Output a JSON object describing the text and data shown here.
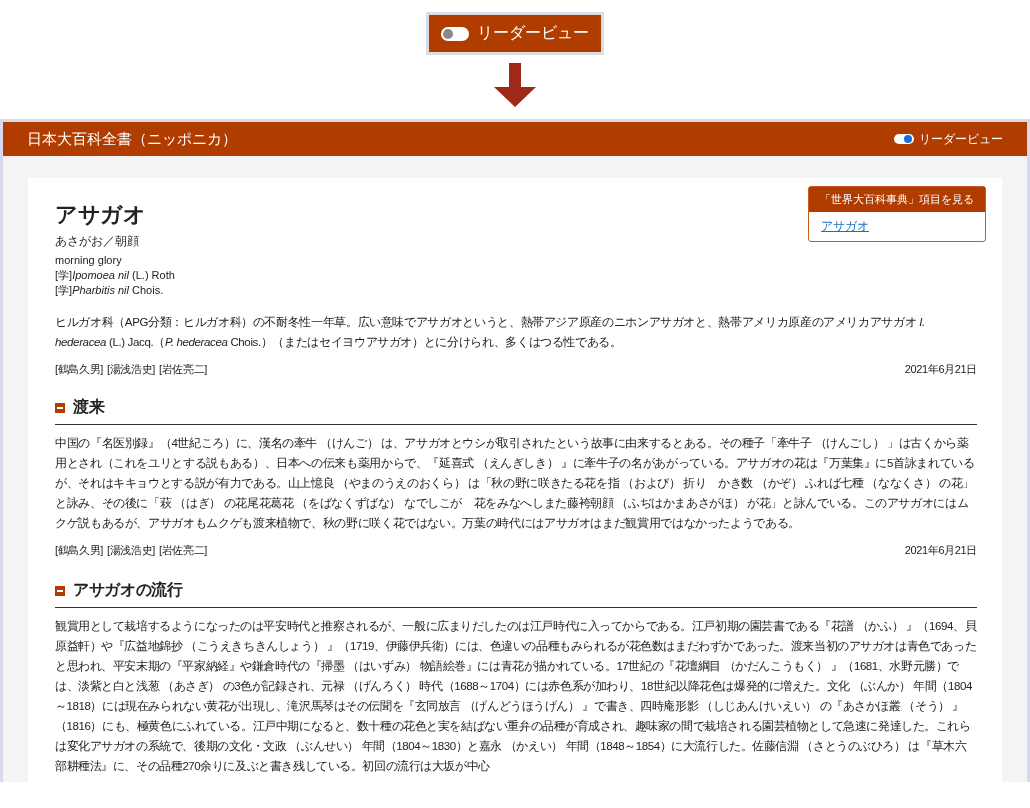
{
  "callout": {
    "toggle": {
      "label": "リーダービュー",
      "on": false
    }
  },
  "frame": {
    "header": {
      "title": "日本大百科全書（ニッポニカ）",
      "toggle": {
        "label": "リーダービュー",
        "on": true
      }
    },
    "article": {
      "title": "アサガオ",
      "reading": "あさがお／朝顔",
      "english": "morning glory",
      "scientific_names": [
        "[学]*Ipomoea nil* (L.) Roth",
        "[学]*Pharbitis nil* Chois."
      ],
      "related_box": {
        "heading": "「世界大百科事典」項目を見る",
        "link": "アサガオ"
      },
      "intro": {
        "text": "ヒルガオ科（APG分類：ヒルガオ科）の不耐冬性一年草。広い意味でアサガオというと、熱帯アジア原産のニホンアサガオと、熱帯アメリカ原産のアメリカアサガオ *I. hederacea* (L.) Jacq.（*P. hederacea* Chois.）（またはセイヨウアサガオ）とに分けられ、多くはつる性である。",
        "authors": [
          "[鶴島久男]",
          "[湯浅浩史]",
          "[岩佐亮二]"
        ],
        "date": "2021年6月21日"
      },
      "sections": [
        {
          "heading": "渡来",
          "text": "中国の『名医別録』（4世紀ころ）に、漢名の牽牛 （けんご） は、アサガオとウシが取引されたという故事に由来するとある。その種子「牽牛子 （けんごし） 」は古くから薬用とされ（これをユリとする説もある）、日本への伝来も薬用からで、『延喜式 （えんぎしき） 』に牽牛子の名があがっている。アサガオの花は『万葉集』に5首詠まれているが、それはキキョウとする説が有力である。山上憶良 （やまのうえのおくら） は「秋の野に咲きたる花を指 （および） 折り　かき数 （かぞ） ふれば七種 （ななくさ） の花」と詠み、その後に「萩 （はぎ） の花尾花葛花 （をばなくずばな） なでしこが　花をみなへしまた藤袴朝顔 （ふぢはかまあさがほ） が花」と詠んでいる。このアサガオにはムクゲ説もあるが、アサガオもムクゲも渡来植物で、秋の野に咲く花ではない。万葉の時代にはアサガオはまだ観賞用ではなかったようである。",
          "authors": [
            "[鶴島久男]",
            "[湯浅浩史]",
            "[岩佐亮二]"
          ],
          "date": "2021年6月21日"
        },
        {
          "heading": "アサガオの流行",
          "text": "観賞用として栽培するようになったのは平安時代と推察されるが、一般に広まりだしたのは江戸時代に入ってからである。江戸初期の園芸書である『花譜 （かふ） 』（1694、貝原益軒）や『広益地錦抄 （こうえきちきんしょう） 』（1719、伊藤伊兵衛）には、色違いの品種もみられるが花色数はまだわずかであった。渡来当初のアサガオは青色であったと思われ、平安末期の『平家納経』や鎌倉時代の『掃墨 （はいずみ） 物語絵巻』には青花が描かれている。17世紀の『花壇綱目 （かだんこうもく） 』（1681、水野元勝）では、淡紫と白と浅葱 （あさぎ） の3色が記録され、元禄 （げんろく） 時代（1688～1704）には赤色系が加わり、18世紀以降花色は爆発的に増えた。文化 （ぶんか） 年間（1804～1818）には現在みられない黄花が出現し、滝沢馬琴はその伝聞を『玄同放言 （げんどうほうげん） 』で書き、四時庵形影 （しじあんけいえい） の『あさかほ叢 （そう） 』（1816）にも、極黄色にふれている。江戸中期になると、数十種の花色と実を結ばない重弁の品種が育成され、趣味家の間で栽培される園芸植物として急速に発達した。これらは変化アサガオの系統で、後期の文化・文政 （ぶんせい） 年間（1804～1830）と嘉永 （かえい） 年間（1848～1854）に大流行した。佐藤信淵 （さとうのぶひろ） は『草木六部耕種法』に、その品種270余りに及ぶと書き残している。初回の流行は大坂が中心"
        }
      ]
    }
  }
}
